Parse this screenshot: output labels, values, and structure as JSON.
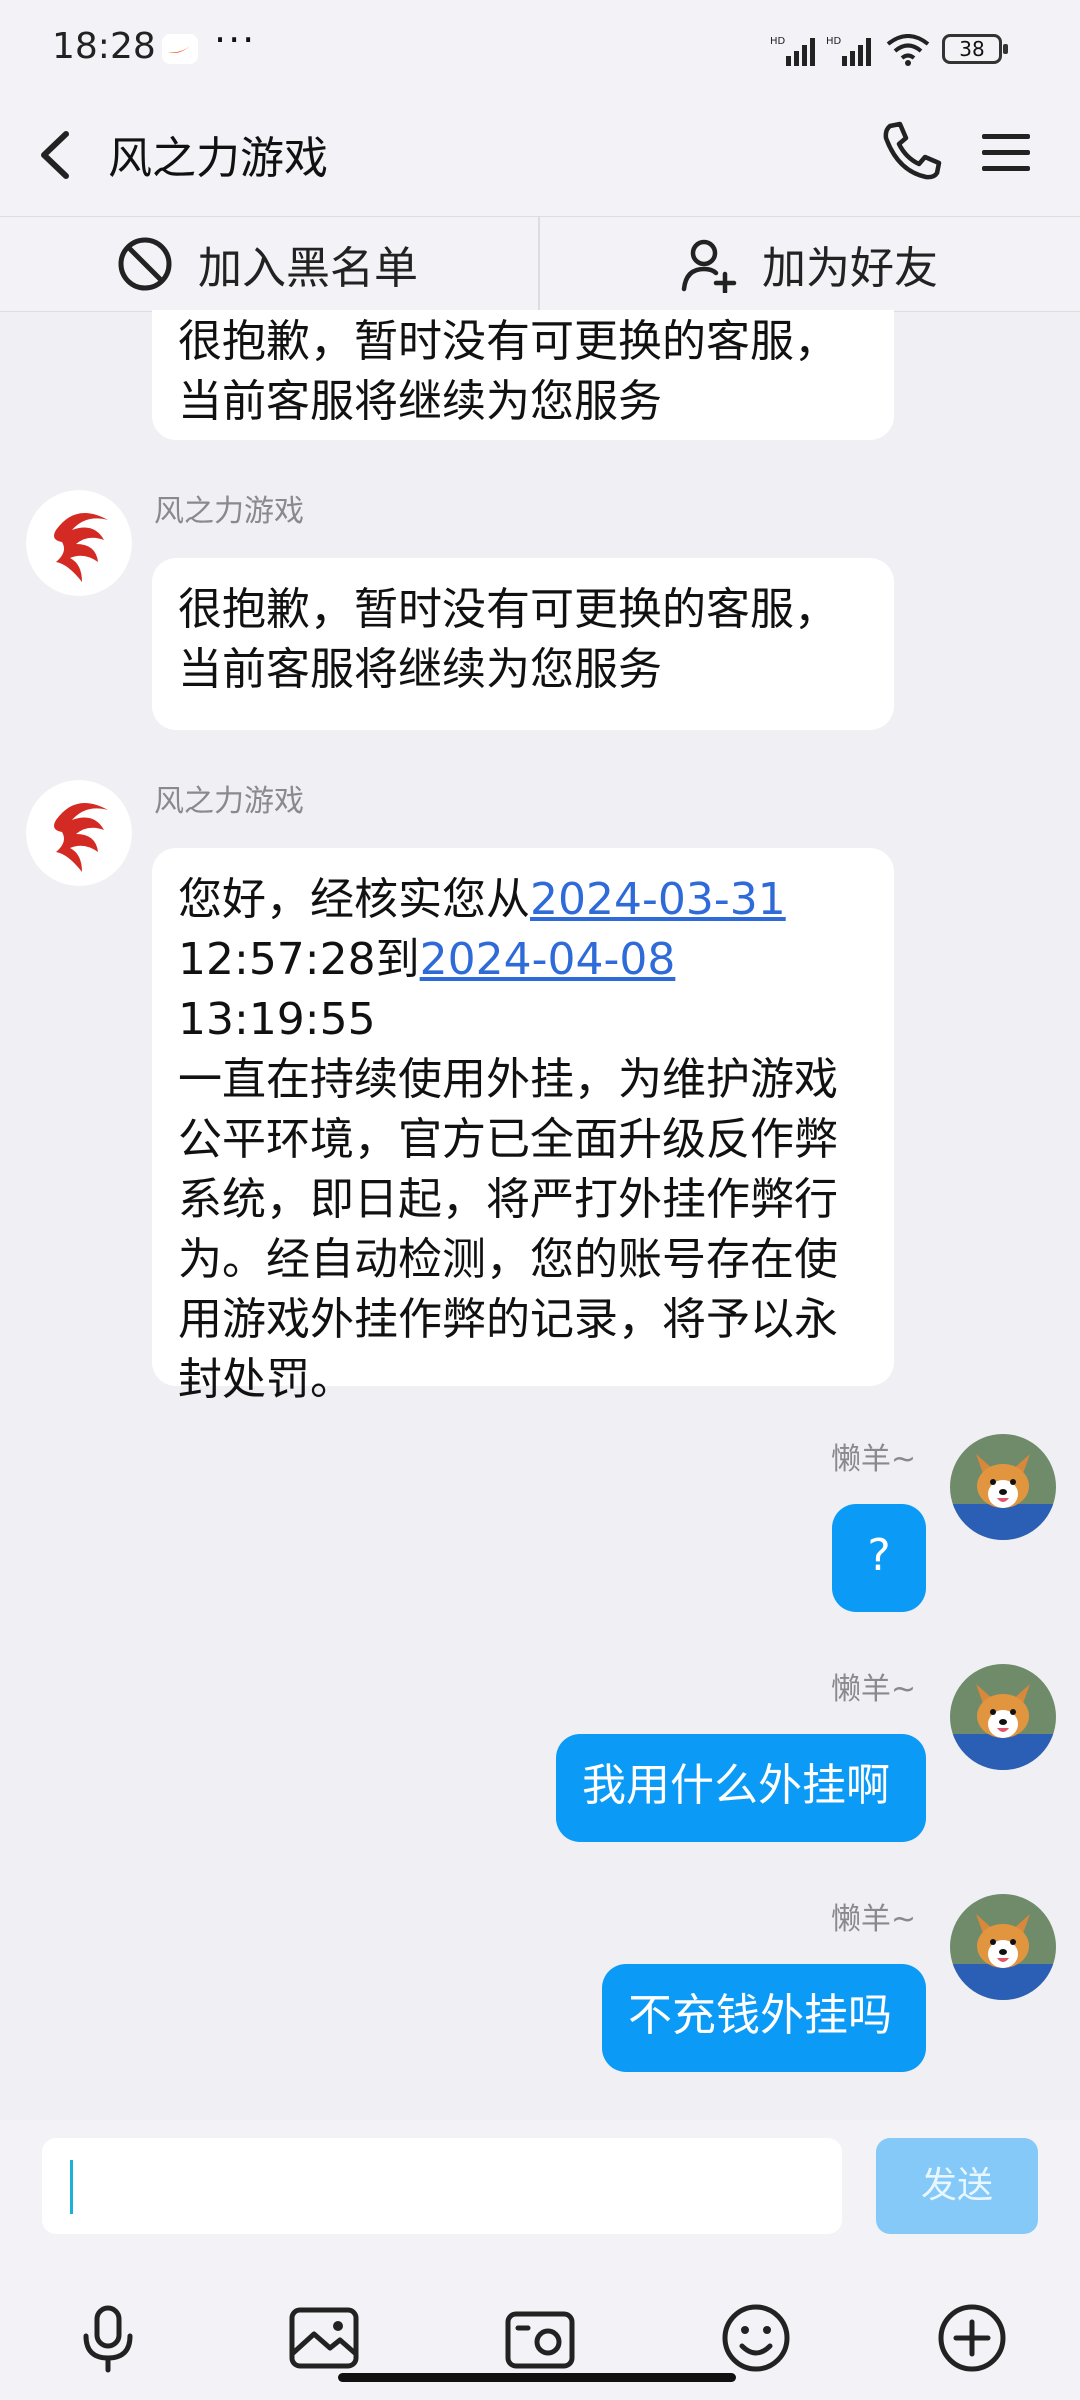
{
  "status": {
    "time": "18:28",
    "battery": "38"
  },
  "header": {
    "title": "风之力游戏"
  },
  "actions": {
    "block": "加入黑名单",
    "add_friend": "加为好友"
  },
  "messages": [
    {
      "sender": "",
      "lines": [
        "很抱歉，暂时没有可更换的客服，",
        "当前客服将继续为您服务"
      ]
    },
    {
      "sender": "风之力游戏",
      "lines": [
        "很抱歉，暂时没有可更换的客服，",
        "当前客服将继续为您服务"
      ]
    },
    {
      "sender": "风之力游戏",
      "parts": {
        "p1": "您好，经核实您从",
        "date1": "2024-03-31",
        "p2": "12:57:28到",
        "date2": "2024-04-08",
        "p3": " 13:19:55",
        "rest": [
          "一直在持续使用外挂，为维护游戏",
          "公平环境，官方已全面升级反作弊",
          "系统，即日起，将严打外挂作弊行",
          "为。经自动检测，您的账号存在使",
          "用游戏外挂作弊的记录，将予以永",
          "封处罚。"
        ]
      }
    },
    {
      "sender": "懒羊~",
      "text": "?"
    },
    {
      "sender": "懒羊~",
      "text": "我用什么外挂啊"
    },
    {
      "sender": "懒羊~",
      "text": "不充钱外挂吗"
    }
  ],
  "input": {
    "value": "",
    "send_label": "发送"
  },
  "toolbar_icons": [
    "microphone-icon",
    "image-icon",
    "camera-icon",
    "emoji-icon",
    "plus-icon"
  ],
  "colors": {
    "accent": "#0b9af6",
    "link": "#2f6bd8",
    "bg": "#efeff4"
  }
}
